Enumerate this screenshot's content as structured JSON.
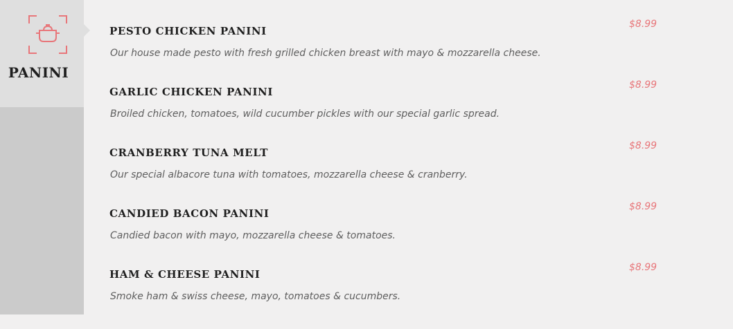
{
  "category": {
    "title": "PANINI",
    "icon": "cooking-pot-icon",
    "accent_color": "#e8767a"
  },
  "menu_items": [
    {
      "name": "PESTO CHICKEN PANINI",
      "description": "Our house made pesto with fresh grilled chicken breast with mayo & mozzarella cheese.",
      "price": "$8.99"
    },
    {
      "name": "GARLIC CHICKEN PANINI",
      "description": "Broiled chicken, tomatoes, wild cucumber pickles with our special garlic spread.",
      "price": "$8.99"
    },
    {
      "name": "CRANBERRY TUNA MELT",
      "description": "Our special albacore tuna with tomatoes, mozzarella cheese & cranberry.",
      "price": "$8.99"
    },
    {
      "name": "CANDIED BACON PANINI",
      "description": "Candied bacon with mayo, mozzarella cheese & tomatoes.",
      "price": "$8.99"
    },
    {
      "name": "HAM & CHEESE PANINI",
      "description": "Smoke ham & swiss cheese, mayo, tomatoes & cucumbers.",
      "price": "$8.99"
    }
  ]
}
